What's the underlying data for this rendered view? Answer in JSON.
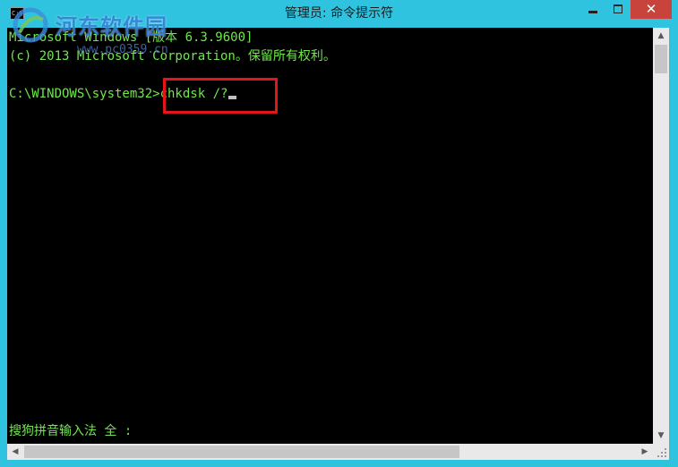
{
  "window": {
    "title": "管理员: 命令提示符",
    "icon_text": "C:\\_",
    "icon": "cmd-icon"
  },
  "watermark": {
    "text": "河东软件园",
    "url": "www.pc0359.cn",
    "logo_icon": "hedong-logo-icon"
  },
  "caption_buttons": {
    "minimize_icon": "minimize-icon",
    "maximize_icon": "maximize-icon",
    "close_icon": "close-icon",
    "close_glyph": "✕"
  },
  "console": {
    "lines": [
      "Microsoft Windows [版本 6.3.9600]",
      "(c) 2013 Microsoft Corporation。保留所有权利。"
    ],
    "prompt": "C:\\WINDOWS\\system32>",
    "command": "chkdsk /?",
    "ime_status": "搜狗拼音输入法 全 :"
  },
  "scrollbars": {
    "up_glyph": "▲",
    "down_glyph": "▼",
    "left_glyph": "◀",
    "right_glyph": "▶"
  },
  "colors": {
    "titlebar": "#2fc3df",
    "console_bg": "#000000",
    "console_text": "#6ee84a",
    "close_button": "#c7433c",
    "highlight": "#e3161c"
  }
}
